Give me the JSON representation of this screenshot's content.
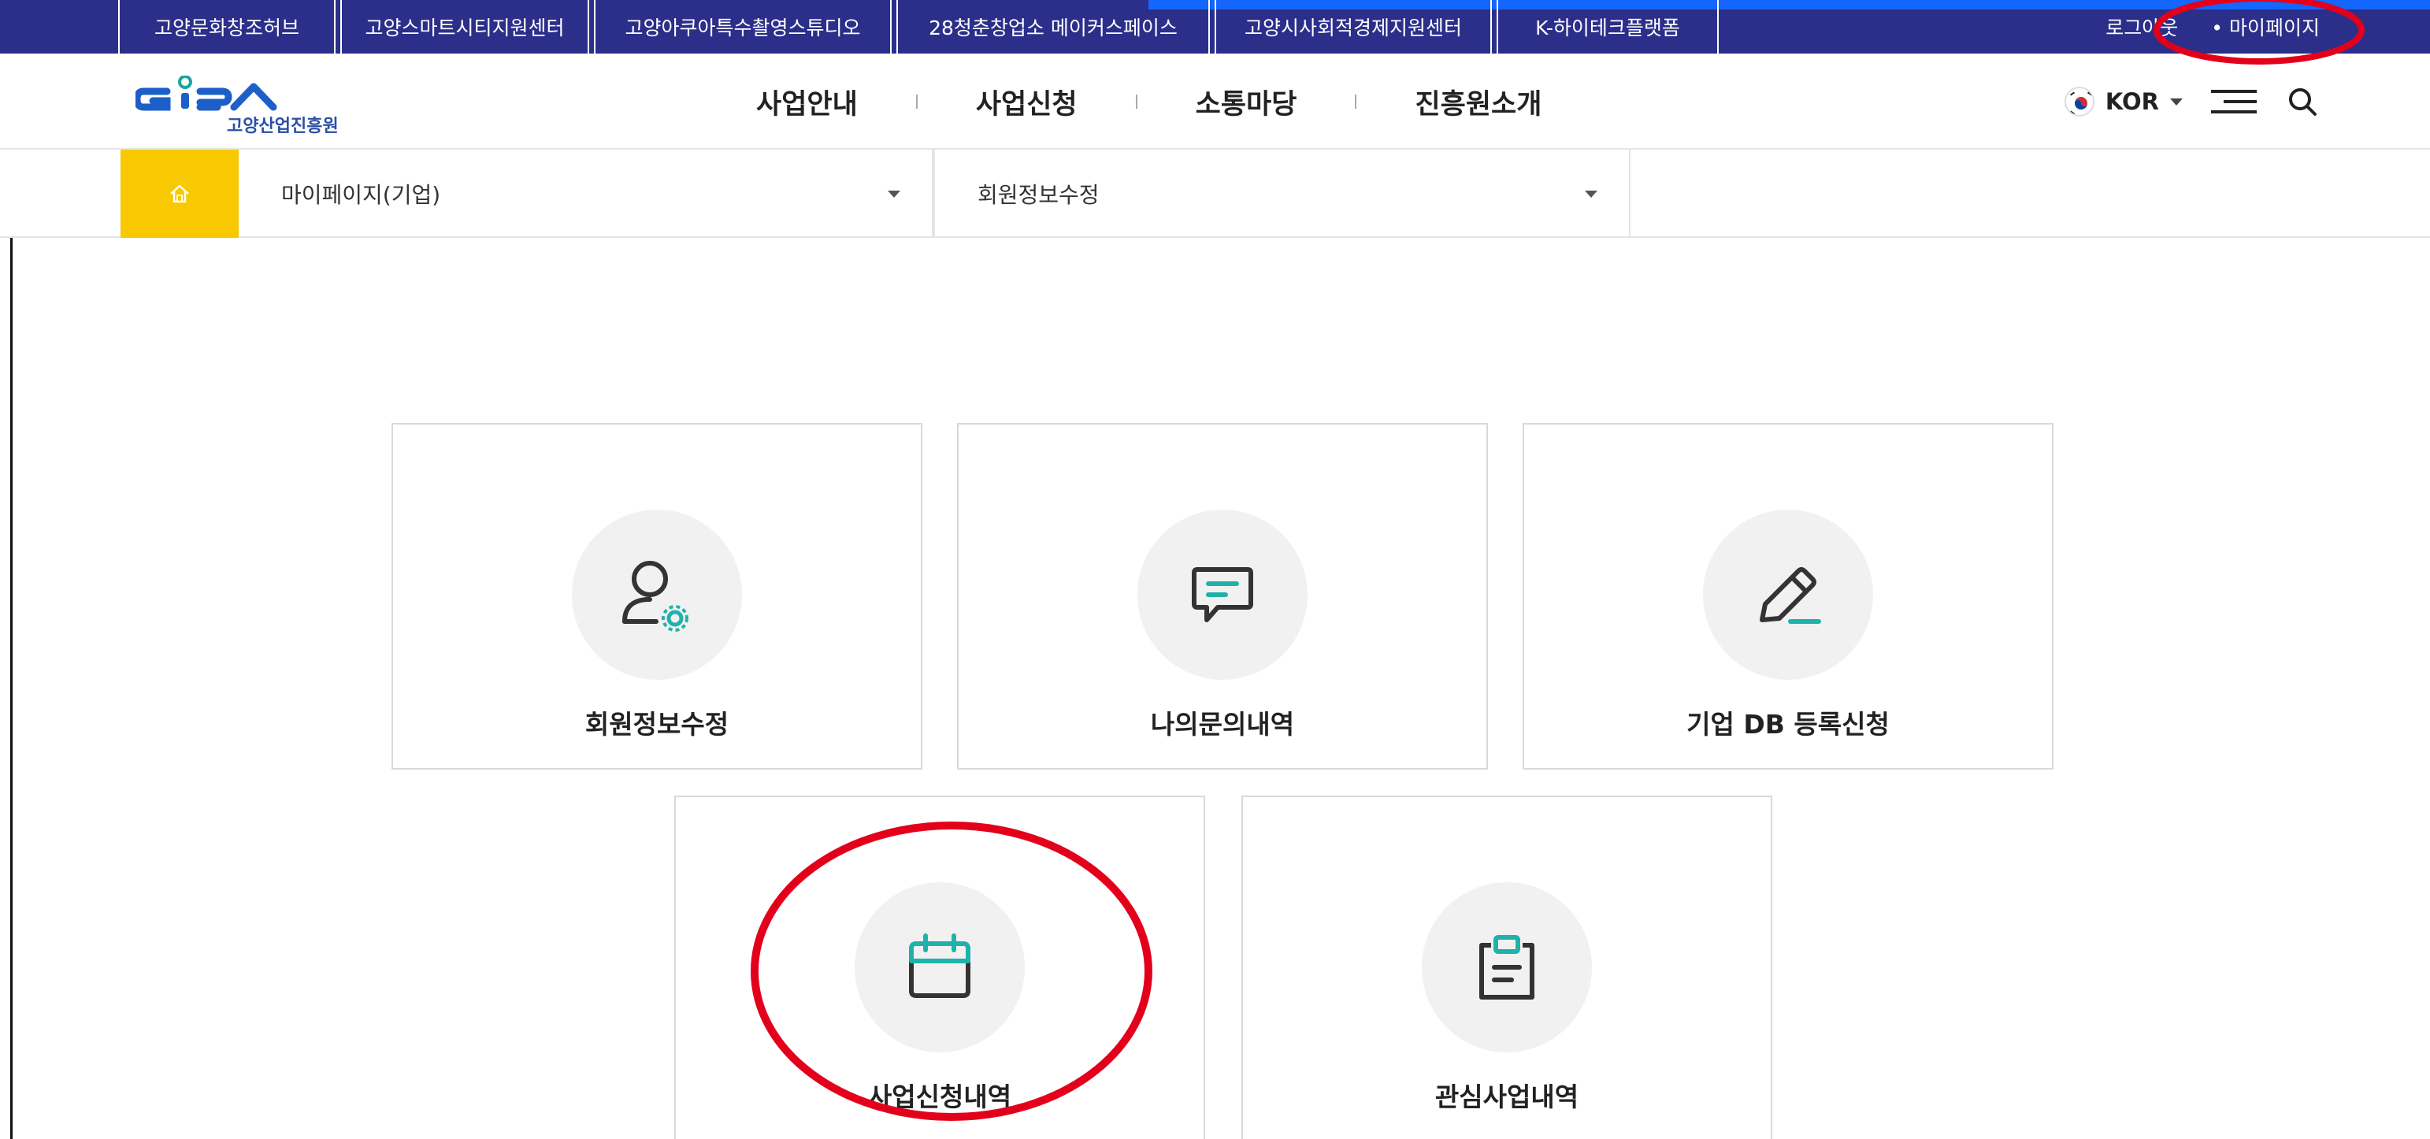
{
  "topbar": {
    "links": [
      {
        "label": "고양문화창조허브"
      },
      {
        "label": "고양스마트시티지원센터"
      },
      {
        "label": "고양아쿠아특수촬영스튜디오"
      },
      {
        "label": "28청춘창업소 메이커스페이스"
      },
      {
        "label": "고양시사회적경제지원센터"
      },
      {
        "label": "K-하이테크플랫폼"
      }
    ],
    "logout_label": "로그아웃",
    "mypage_label": "• 마이페이지"
  },
  "header": {
    "logo_sub": "고양산업진흥원",
    "nav": [
      {
        "label": "사업안내"
      },
      {
        "label": "사업신청"
      },
      {
        "label": "소통마당"
      },
      {
        "label": "진흥원소개"
      }
    ],
    "language": "KOR"
  },
  "location": {
    "depth1": "마이페이지(기업)",
    "depth2": "회원정보수정"
  },
  "cards": [
    {
      "label": "회원정보수정",
      "icon": "user-settings-icon"
    },
    {
      "label": "나의문의내역",
      "icon": "chat-icon"
    },
    {
      "label": "기업 DB 등록신청",
      "icon": "pencil-icon"
    },
    {
      "label": "사업신청내역",
      "icon": "calendar-icon"
    },
    {
      "label": "관심사업내역",
      "icon": "clipboard-icon"
    }
  ],
  "colors": {
    "topbar": "#2b2f8a",
    "accent_teal": "#20b2aa",
    "home_box": "#f8c800",
    "annotation": "#e3001b"
  }
}
